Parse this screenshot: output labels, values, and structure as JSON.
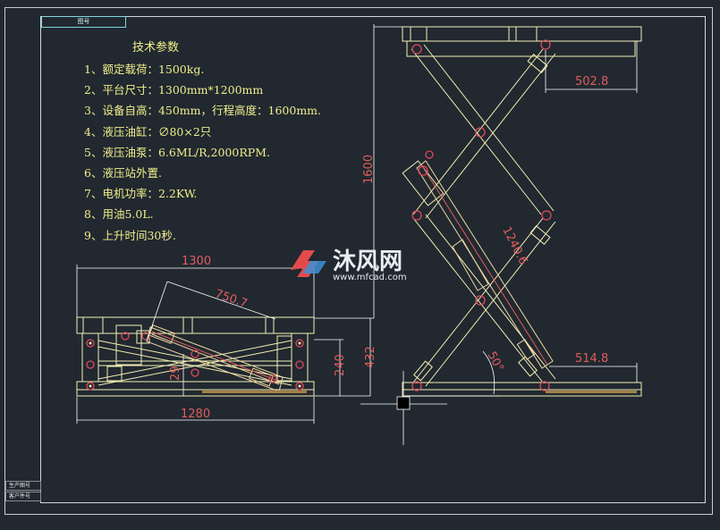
{
  "drawing": {
    "tag_label": "图号",
    "side_labels": [
      "生产图号",
      "客户件号"
    ]
  },
  "specs": {
    "title": "技术参数",
    "lines": [
      "1、额定载荷：1500kg.",
      "2、平台尺寸：1300mm*1200mm",
      "3、设备自高：450mm，行程高度：1600mm.",
      "4、液压油缸：∅80×2只",
      "5、液压油泵：6.6ML/R,2000RPM.",
      "6、液压站外置.",
      "7、电机功率：2.2KW.",
      "8、用油5.0L.",
      "9、上升时间30秒."
    ]
  },
  "dimensions": {
    "lowered_platform_length": "1300",
    "lowered_base_length": "1280",
    "lowered_cylinder_length": "750.7",
    "lowered_height_total": "432",
    "lowered_height_frame": "240",
    "lowered_pin_offset": "29",
    "raised_stroke": "1600",
    "raised_top_offset": "502.8",
    "raised_bottom_offset": "514.8",
    "raised_cylinder_length": "1240.6",
    "raised_angle": "50°"
  },
  "watermark": {
    "name": "沐风网",
    "url": "www.mfcad.com"
  },
  "colors": {
    "background": "#212830",
    "structure": "#f3efb3",
    "dimension": "#e25d5d",
    "hole": "#e0485c",
    "cylinder": "#f0d8a0",
    "specs_text": "#f0ef8a"
  }
}
